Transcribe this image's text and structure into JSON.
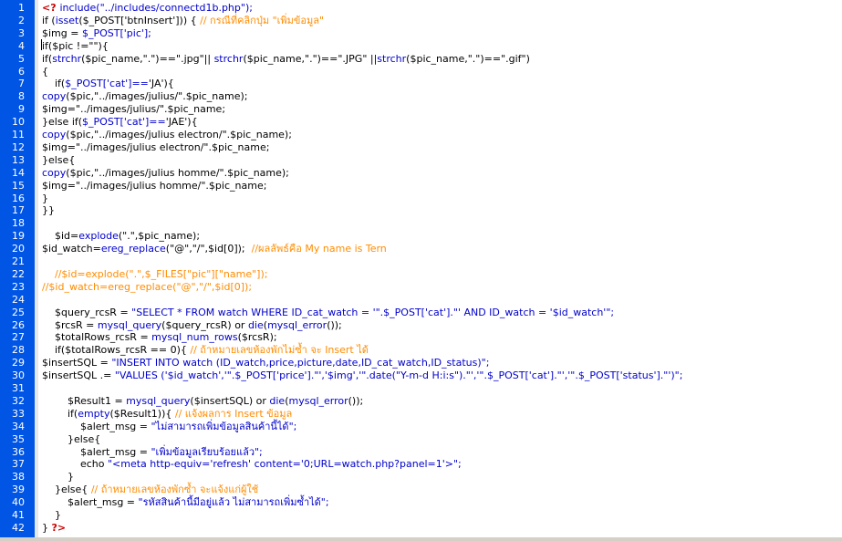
{
  "editor": {
    "colors": {
      "gutter_bg": "#0055e5",
      "gutter_text": "#ffffff",
      "php_tag": "#cc0000",
      "function": "#0000cc",
      "string": "#0000cc",
      "comment": "#ff8c00",
      "default": "#000000"
    },
    "lines": [
      {
        "n": "1",
        "tokens": [
          {
            "t": "<? ",
            "c": "php"
          },
          {
            "t": "include",
            "c": "fn"
          },
          {
            "t": "(\"../includes/connectd1b.php\");",
            "c": "str"
          }
        ]
      },
      {
        "n": "2",
        "tokens": [
          {
            "t": "if (",
            "c": "op"
          },
          {
            "t": "isset",
            "c": "fn"
          },
          {
            "t": "($_POST['btnInsert'])) { ",
            "c": "op"
          },
          {
            "t": "// กรณีที่คลิกปุ่ม \"เพิ่มข้อมูล\"",
            "c": "cm"
          }
        ]
      },
      {
        "n": "3",
        "tokens": [
          {
            "t": "$img = ",
            "c": "var"
          },
          {
            "t": "$_POST['pic'];",
            "c": "str"
          }
        ]
      },
      {
        "n": "4",
        "tokens": [
          {
            "t": "if($pic !=\"\"){",
            "c": "op"
          }
        ]
      },
      {
        "n": "5",
        "tokens": [
          {
            "t": "if(",
            "c": "op"
          },
          {
            "t": "strchr",
            "c": "fn"
          },
          {
            "t": "($pic_name,\".\")==\".jpg\"|| ",
            "c": "op"
          },
          {
            "t": "strchr",
            "c": "fn"
          },
          {
            "t": "($pic_name,\".\")==\".JPG\" ||",
            "c": "op"
          },
          {
            "t": "strchr",
            "c": "fn"
          },
          {
            "t": "($pic_name,\".\")==\".gif\")",
            "c": "op"
          }
        ]
      },
      {
        "n": "6",
        "tokens": [
          {
            "t": "{",
            "c": "brace"
          }
        ]
      },
      {
        "n": "7",
        "tokens": [
          {
            "t": "    if(",
            "c": "op"
          },
          {
            "t": "$_POST['cat']==",
            "c": "str"
          },
          {
            "t": "'JA'){",
            "c": "op"
          }
        ]
      },
      {
        "n": "8",
        "tokens": [
          {
            "t": "copy",
            "c": "fn"
          },
          {
            "t": "($pic,\"../images/julius/\".$pic_name);",
            "c": "op"
          }
        ]
      },
      {
        "n": "9",
        "tokens": [
          {
            "t": "$img=\"../images/julius/\".$pic_name;",
            "c": "op"
          }
        ]
      },
      {
        "n": "10",
        "tokens": [
          {
            "t": "}else if(",
            "c": "op"
          },
          {
            "t": "$_POST['cat']==",
            "c": "str"
          },
          {
            "t": "'JAE'){",
            "c": "op"
          }
        ]
      },
      {
        "n": "11",
        "tokens": [
          {
            "t": "copy",
            "c": "fn"
          },
          {
            "t": "($pic,\"../images/julius electron/\".$pic_name);",
            "c": "op"
          }
        ]
      },
      {
        "n": "12",
        "tokens": [
          {
            "t": "$img=\"../images/julius electron/\".$pic_name;",
            "c": "op"
          }
        ]
      },
      {
        "n": "13",
        "tokens": [
          {
            "t": "}else{",
            "c": "op"
          }
        ]
      },
      {
        "n": "14",
        "tokens": [
          {
            "t": "copy",
            "c": "fn"
          },
          {
            "t": "($pic,\"../images/julius homme/\".$pic_name);",
            "c": "op"
          }
        ]
      },
      {
        "n": "15",
        "tokens": [
          {
            "t": "$img=\"../images/julius homme/\".$pic_name;",
            "c": "op"
          }
        ]
      },
      {
        "n": "16",
        "tokens": [
          {
            "t": "}",
            "c": "brace"
          }
        ]
      },
      {
        "n": "17",
        "tokens": [
          {
            "t": "}}",
            "c": "brace"
          }
        ]
      },
      {
        "n": "18",
        "tokens": []
      },
      {
        "n": "19",
        "tokens": [
          {
            "t": "    $id=",
            "c": "op"
          },
          {
            "t": "explode",
            "c": "fn"
          },
          {
            "t": "(\".\",$pic_name);",
            "c": "op"
          }
        ]
      },
      {
        "n": "20",
        "tokens": [
          {
            "t": "$id_watch=",
            "c": "op"
          },
          {
            "t": "ereg_replace",
            "c": "fn"
          },
          {
            "t": "(\"@\",\"/\",$id[0]);  ",
            "c": "op"
          },
          {
            "t": "//ผลลัพธ์คือ My name is Tern",
            "c": "cm"
          }
        ]
      },
      {
        "n": "21",
        "tokens": []
      },
      {
        "n": "22",
        "tokens": [
          {
            "t": "    //$id=explode(\".\",$_FILES[\"pic\"][\"name\"]);",
            "c": "cm"
          }
        ]
      },
      {
        "n": "23",
        "tokens": [
          {
            "t": "//$id_watch=ereg_replace(\"@\",\"/\",$id[0]);",
            "c": "cm"
          }
        ]
      },
      {
        "n": "24",
        "tokens": []
      },
      {
        "n": "25",
        "tokens": [
          {
            "t": "    $query_rcsR = ",
            "c": "op"
          },
          {
            "t": "\"SELECT * FROM watch WHERE ID_cat_watch = '\".$_POST['cat'].\"' AND ID_watch = '$id_watch'\";",
            "c": "str"
          }
        ]
      },
      {
        "n": "26",
        "tokens": [
          {
            "t": "    $rcsR = ",
            "c": "op"
          },
          {
            "t": "mysql_query",
            "c": "fn"
          },
          {
            "t": "($query_rcsR) or ",
            "c": "op"
          },
          {
            "t": "die",
            "c": "fn"
          },
          {
            "t": "(",
            "c": "op"
          },
          {
            "t": "mysql_error",
            "c": "fn"
          },
          {
            "t": "());",
            "c": "op"
          }
        ]
      },
      {
        "n": "27",
        "tokens": [
          {
            "t": "    $totalRows_rcsR = ",
            "c": "op"
          },
          {
            "t": "mysql_num_rows",
            "c": "fn"
          },
          {
            "t": "($rcsR);",
            "c": "op"
          }
        ]
      },
      {
        "n": "28",
        "tokens": [
          {
            "t": "    if($totalRows_rcsR == 0){ ",
            "c": "op"
          },
          {
            "t": "// ถ้าหมายเลขห้องพักไม่ซ้ำ จะ Insert ได้",
            "c": "cm"
          }
        ]
      },
      {
        "n": "29",
        "tokens": [
          {
            "t": "$insertSQL = ",
            "c": "op"
          },
          {
            "t": "\"INSERT INTO watch (ID_watch,price,picture,date,ID_cat_watch,ID_status)\";",
            "c": "str"
          }
        ]
      },
      {
        "n": "30",
        "tokens": [
          {
            "t": "$insertSQL .= ",
            "c": "op"
          },
          {
            "t": "\"VALUES ('$id_watch','\".$_POST['price'].\"','$img','\".date(\"Y-m-d H:i:s\").\"','\".$_POST['cat'].\"','\".$_POST['status'].\"')\";",
            "c": "str"
          }
        ]
      },
      {
        "n": "31",
        "tokens": []
      },
      {
        "n": "32",
        "tokens": [
          {
            "t": "        $Result1 = ",
            "c": "op"
          },
          {
            "t": "mysql_query",
            "c": "fn"
          },
          {
            "t": "($insertSQL) or ",
            "c": "op"
          },
          {
            "t": "die",
            "c": "fn"
          },
          {
            "t": "(",
            "c": "op"
          },
          {
            "t": "mysql_error",
            "c": "fn"
          },
          {
            "t": "());",
            "c": "op"
          }
        ]
      },
      {
        "n": "33",
        "tokens": [
          {
            "t": "        if(",
            "c": "op"
          },
          {
            "t": "empty",
            "c": "fn"
          },
          {
            "t": "($Result1)){ ",
            "c": "op"
          },
          {
            "t": "// แจ้งผลการ Insert ข้อมูล",
            "c": "cm"
          }
        ]
      },
      {
        "n": "34",
        "tokens": [
          {
            "t": "            $alert_msg = ",
            "c": "op"
          },
          {
            "t": "\"ไม่สามารถเพิ่มข้อมูลสินค้านี้ได้\";",
            "c": "str"
          }
        ]
      },
      {
        "n": "35",
        "tokens": [
          {
            "t": "        }else{",
            "c": "op"
          }
        ]
      },
      {
        "n": "36",
        "tokens": [
          {
            "t": "            $alert_msg = ",
            "c": "op"
          },
          {
            "t": "\"เพิ่มข้อมูลเรียบร้อยแล้ว\";",
            "c": "str"
          }
        ]
      },
      {
        "n": "37",
        "tokens": [
          {
            "t": "            echo ",
            "c": "op"
          },
          {
            "t": "\"<meta http-equiv='refresh' content='0;URL=watch.php?panel=1'>\";",
            "c": "str"
          }
        ]
      },
      {
        "n": "38",
        "tokens": [
          {
            "t": "        }",
            "c": "brace"
          }
        ]
      },
      {
        "n": "39",
        "tokens": [
          {
            "t": "    }else{ ",
            "c": "op"
          },
          {
            "t": "// ถ้าหมายเลขห้องพักซ้ำ จะแจ้งแก่ผู้ใช้",
            "c": "cm"
          }
        ]
      },
      {
        "n": "40",
        "tokens": [
          {
            "t": "        $alert_msg = ",
            "c": "op"
          },
          {
            "t": "\"รหัสสินค้านี้มีอยู่แล้ว ไม่สามารถเพิ่มซ้ำได้\";",
            "c": "str"
          }
        ]
      },
      {
        "n": "41",
        "tokens": [
          {
            "t": "    }",
            "c": "brace"
          }
        ]
      },
      {
        "n": "42",
        "tokens": [
          {
            "t": "} ",
            "c": "brace"
          },
          {
            "t": "?>",
            "c": "php"
          }
        ]
      }
    ]
  }
}
